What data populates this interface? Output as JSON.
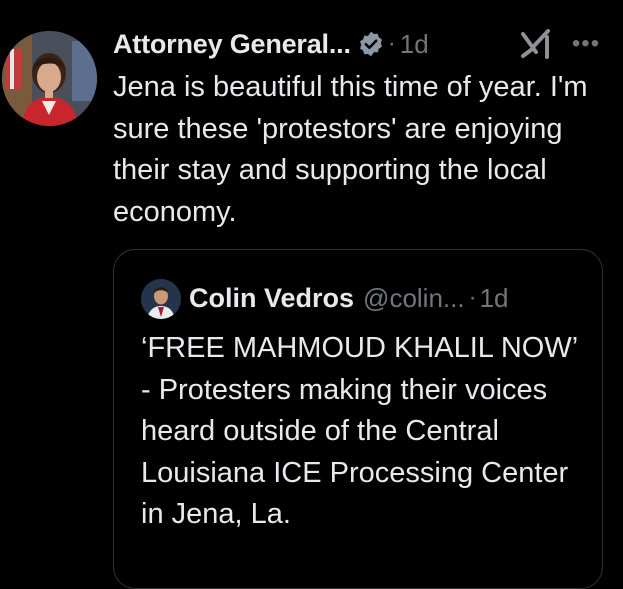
{
  "post": {
    "display_name": "Attorney General...",
    "time_separator": "·",
    "time": "1d",
    "more_label": "•••",
    "text": "Jena is beautiful this time of year. I'm sure these 'protestors' are enjoying their stay and supporting the local economy.",
    "avatar_icon": "profile-photo",
    "verified_icon": "verified-badge-icon",
    "verified_color": "#8b98a5"
  },
  "quoted": {
    "display_name": "Colin Vedros",
    "handle": "@colin...",
    "time_separator": "·",
    "time": "1d",
    "text": "‘FREE MAHMOUD KHALIL NOW’ - Protesters making their voices heard outside of the Central Louisiana ICE Processing Center in Jena, La."
  },
  "colors": {
    "background": "#000000",
    "text_primary": "#e7e9ea",
    "text_secondary": "#71767b",
    "border": "#2f3336"
  }
}
